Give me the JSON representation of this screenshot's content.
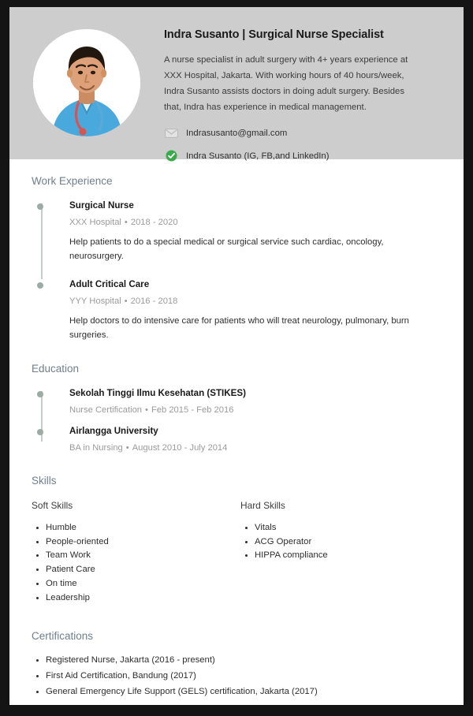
{
  "header": {
    "name_title": "Indra Susanto | Surgical Nurse Specialist",
    "summary": "A nurse specialist in adult surgery with 4+ years experience at XXX Hospital, Jakarta. With working hours of 40 hours/week, Indra Susanto assists doctors in doing adult surgery. Besides that, Indra has experience in medical management.",
    "contacts": [
      {
        "icon": "envelope-icon",
        "text": "Indrasusanto@gmail.com"
      },
      {
        "icon": "verified-check-icon",
        "text": "Indra Susanto (IG, FB,and LinkedIn)"
      }
    ],
    "band_color": "#cdcdcd"
  },
  "work": {
    "title": "Work Experience",
    "items": [
      {
        "role": "Surgical Nurse",
        "org": "XXX Hospital",
        "dates": "2018 - 2020",
        "desc": "Help patients to do a special medical or surgical service such cardiac, oncology, neurosurgery."
      },
      {
        "role": "Adult Critical Care",
        "org": "YYY Hospital",
        "dates": "2016 - 2018",
        "desc": "Help doctors to do intensive care for patients who will treat neurology, pulmonary, burn surgeries."
      }
    ]
  },
  "education": {
    "title": "Education",
    "items": [
      {
        "role": "Sekolah Tinggi Ilmu Kesehatan (STIKES)",
        "org": "Nurse Certification",
        "dates": "Feb 2015 - Feb 2016"
      },
      {
        "role": "Airlangga University",
        "org": "BA in Nursing",
        "dates": "August 2010 - July 2014"
      }
    ]
  },
  "skills": {
    "title": "Skills",
    "soft": {
      "label": "Soft Skills",
      "items": [
        "Humble",
        "People-oriented",
        "Team Work",
        "Patient Care",
        "On time",
        "Leadership"
      ]
    },
    "hard": {
      "label": "Hard Skills",
      "items": [
        "Vitals",
        "ACG Operator",
        "HIPPA compliance"
      ]
    }
  },
  "certifications": {
    "title": "Certifications",
    "items": [
      "Registered Nurse, Jakarta (2016 - present)",
      "First Aid Certification, Bandung (2017)",
      "General Emergency Life Support (GELS) certification, Jakarta (2017)"
    ]
  },
  "separator": "•"
}
